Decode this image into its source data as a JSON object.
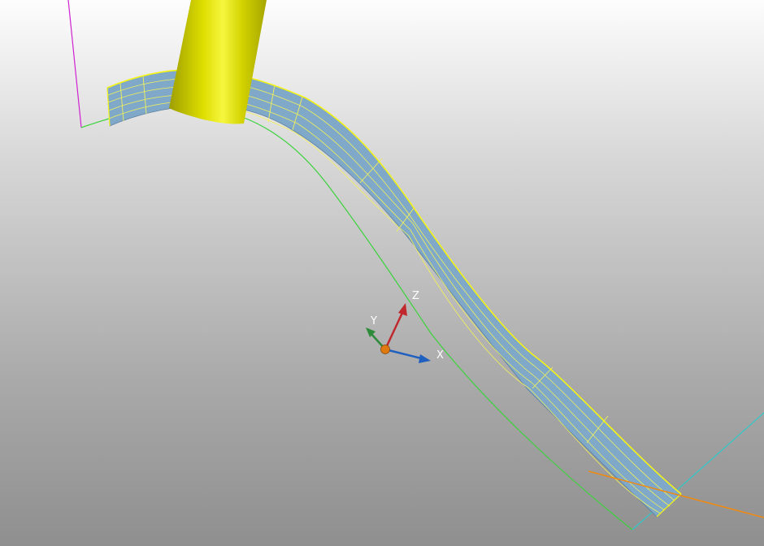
{
  "viewport": {
    "background_top": "#fdfdfd",
    "background_bottom": "#8f8f8f"
  },
  "triad": {
    "x_label": "X",
    "y_label": "Y",
    "z_label": "Z",
    "x_color": "#1f5fbf",
    "y_color": "#2e8b3a",
    "z_color": "#c0282d",
    "origin_color": "#e07a10"
  },
  "colors": {
    "surface_fill": "#7fa8c9",
    "surface_mesh": "#f2f25a",
    "surface_edge": "#f5f515",
    "tool": "#d8d800",
    "guide_curve": "#3cd23c",
    "magenta_line": "#d020d0",
    "cyan_line": "#30c8c8",
    "orange_line": "#f08a10"
  }
}
